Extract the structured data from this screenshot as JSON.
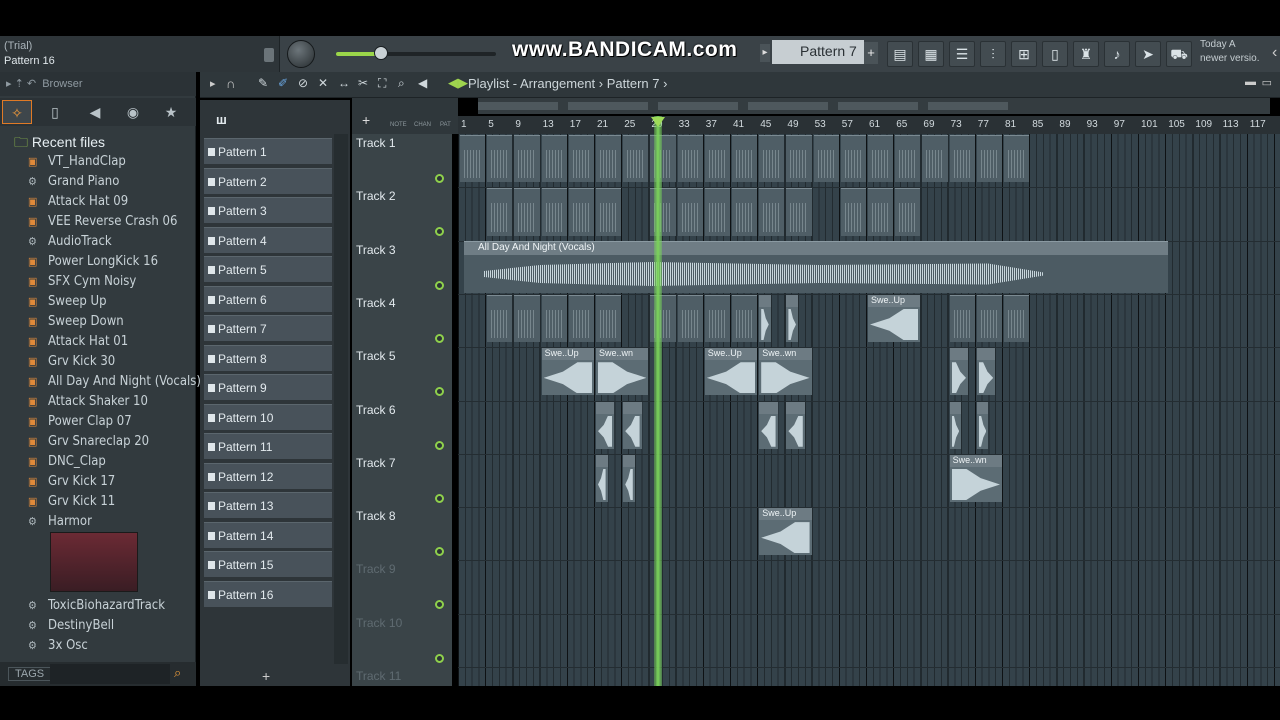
{
  "hint": {
    "line1": "(Trial)",
    "line2": "Pattern 16"
  },
  "watermark": "www.BANDICAM.com",
  "toolbar": {
    "pattern_selector": "Pattern 7",
    "add": "+"
  },
  "news": {
    "line1": "Today  A",
    "line2": "newer versio."
  },
  "browser": {
    "title": "Browser",
    "section": "Recent files",
    "items": [
      {
        "label": "VT_HandClap",
        "icon": "audio-file-icon"
      },
      {
        "label": "Grand Piano",
        "icon": "plugin-icon"
      },
      {
        "label": "Attack Hat 09",
        "icon": "audio-file-icon"
      },
      {
        "label": "VEE Reverse Crash 06",
        "icon": "audio-file-icon"
      },
      {
        "label": "AudioTrack",
        "icon": "plugin-icon"
      },
      {
        "label": "Power LongKick 16",
        "icon": "audio-file-icon"
      },
      {
        "label": "SFX Cym Noisy",
        "icon": "audio-file-icon"
      },
      {
        "label": "Sweep Up",
        "icon": "audio-file-icon"
      },
      {
        "label": "Sweep Down",
        "icon": "audio-file-icon"
      },
      {
        "label": "Attack Hat 01",
        "icon": "audio-file-icon"
      },
      {
        "label": "Grv Kick 30",
        "icon": "audio-file-icon"
      },
      {
        "label": "All Day And Night (Vocals)",
        "icon": "audio-file-icon"
      },
      {
        "label": "Attack Shaker 10",
        "icon": "audio-file-icon"
      },
      {
        "label": "Power Clap 07",
        "icon": "audio-file-icon"
      },
      {
        "label": "Grv Snareclap 20",
        "icon": "audio-file-icon"
      },
      {
        "label": "DNC_Clap",
        "icon": "audio-file-icon"
      },
      {
        "label": "Grv Kick 17",
        "icon": "audio-file-icon"
      },
      {
        "label": "Grv Kick 11",
        "icon": "audio-file-icon"
      },
      {
        "label": "Harmor",
        "icon": "plugin-icon"
      }
    ],
    "items_after_thumb": [
      {
        "label": "ToxicBiohazardTrack",
        "icon": "plugin-icon"
      },
      {
        "label": "DestinyBell",
        "icon": "plugin-icon"
      },
      {
        "label": "3x Osc",
        "icon": "plugin-icon"
      }
    ],
    "tags": "TAGS"
  },
  "playlist": {
    "title": "Playlist - Arrangement",
    "current_pattern": "Pattern 7",
    "ruler_labels": [
      "NOTE",
      "CHAN",
      "PAT"
    ],
    "bars": [
      "1",
      "5",
      "9",
      "13",
      "17",
      "21",
      "25",
      "29",
      "33",
      "37",
      "41",
      "45",
      "49",
      "53",
      "57",
      "61",
      "65",
      "69",
      "73",
      "77",
      "81",
      "85",
      "89",
      "93",
      "97",
      "101",
      "105",
      "109",
      "113",
      "117"
    ],
    "patterns": [
      "Pattern 1",
      "Pattern 2",
      "Pattern 3",
      "Pattern 4",
      "Pattern 5",
      "Pattern 6",
      "Pattern 7",
      "Pattern 8",
      "Pattern 9",
      "Pattern 10",
      "Pattern 11",
      "Pattern 12",
      "Pattern 13",
      "Pattern 14",
      "Pattern 15",
      "Pattern 16"
    ],
    "tracks": [
      "Track 1",
      "Track 2",
      "Track 3",
      "Track 4",
      "Track 5",
      "Track 6",
      "Track 7",
      "Track 8",
      "Track 9",
      "Track 10",
      "Track 11"
    ],
    "vocal_clip": "All Day And Night (Vocals)",
    "sweep_up": "Swe..Up",
    "sweep_down": "Swe..wn"
  }
}
